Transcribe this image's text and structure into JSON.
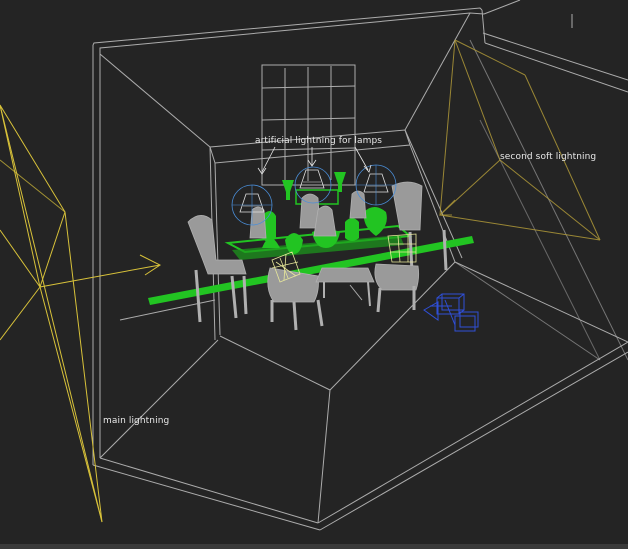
{
  "annotations": {
    "lamps": "artificial  lightning for lamps",
    "soft": "second soft lightning",
    "main": "main lightning"
  },
  "colors": {
    "background": "#242424",
    "wire": "#c8c8c8",
    "furniture": "#9a9a9a",
    "light": "#d8c23a",
    "selected": "#22c422",
    "camera": "#2f4fd8",
    "lamp_gizmo": "#4a8ed8",
    "cushion": "#e8e89a"
  }
}
